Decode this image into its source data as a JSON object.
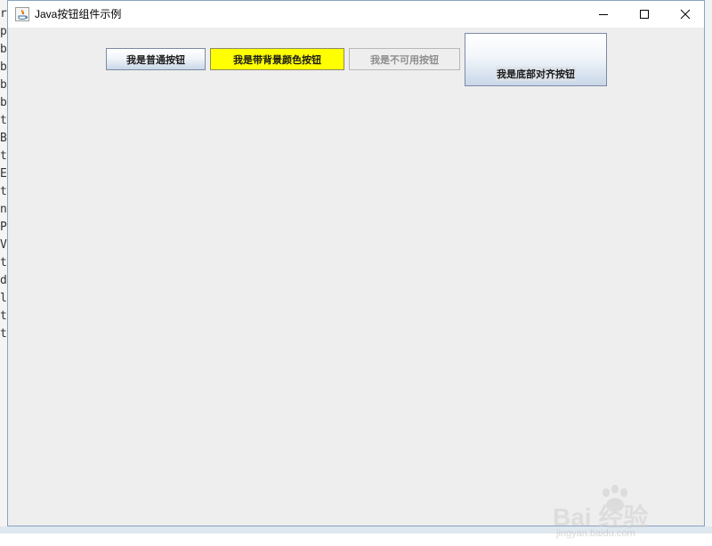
{
  "background_editor": {
    "gutter_chars": [
      "r",
      "p",
      "b",
      "b",
      "b",
      "b",
      "t",
      "B",
      "t",
      "E",
      "t",
      "n",
      "P",
      "V",
      "t",
      "d",
      "l",
      "t",
      "t"
    ]
  },
  "window": {
    "title": "Java按钮组件示例",
    "controls": {
      "minimize_icon": "minimize-icon",
      "maximize_icon": "maximize-icon",
      "close_icon": "close-icon"
    }
  },
  "buttons": {
    "normal": {
      "label": "我是普通按钮"
    },
    "yellow": {
      "label": "我是带背景颜色按钮",
      "background": "#ffff00"
    },
    "disabled": {
      "label": "我是不可用按钮",
      "enabled": false
    },
    "bottom_aligned": {
      "label": "我是底部对齐按钮"
    }
  },
  "watermark": {
    "logo": "Bai 经验",
    "url": "jingyan.baidu.com"
  },
  "colors": {
    "window_bg": "#eeeeee",
    "window_border": "#8aa3c2",
    "button_border": "#7a8aa3"
  }
}
